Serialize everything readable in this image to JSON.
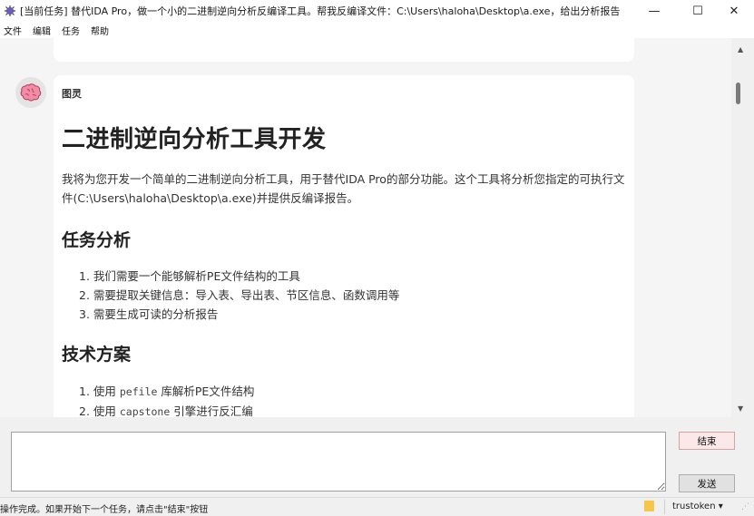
{
  "window": {
    "title": "[当前任务] 替代IDA Pro，做一个小的二进制逆向分析反编译工具。帮我反编译文件：C:\\Users\\haloha\\Desktop\\a.exe，给出分析报告",
    "minimize": "—",
    "maximize": "☐",
    "close": "✕"
  },
  "menu": [
    "文件",
    "编辑",
    "任务",
    "帮助"
  ],
  "message": {
    "sender": "图灵",
    "heading": "二进制逆向分析工具开发",
    "intro": "我将为您开发一个简单的二进制逆向分析工具，用于替代IDA Pro的部分功能。这个工具将分析您指定的可执行文件(C:\\Users\\haloha\\Desktop\\a.exe)并提供反编译报告。",
    "section1": {
      "title": "任务分析",
      "items": [
        "1. 我们需要一个能够解析PE文件结构的工具",
        "2. 需要提取关键信息：导入表、导出表、节区信息、函数调用等",
        "3. 需要生成可读的分析报告"
      ]
    },
    "section2": {
      "title": "技术方案",
      "items": [
        {
          "pre": "1. 使用 ",
          "code": "pefile",
          "post": " 库解析PE文件结构"
        },
        {
          "pre": "2. 使用 ",
          "code": "capstone",
          "post": " 引擎进行反汇编"
        }
      ]
    }
  },
  "buttons": {
    "end": "结束",
    "send": "发送"
  },
  "input": {
    "value": ""
  },
  "status": {
    "message": "操作完成。如果开始下一个任务，请点击\"结束\"按钮",
    "model": "trustoken ▾"
  },
  "icons": {
    "app": "app-icon",
    "avatar": "brain-icon",
    "folder": "folder-icon"
  }
}
